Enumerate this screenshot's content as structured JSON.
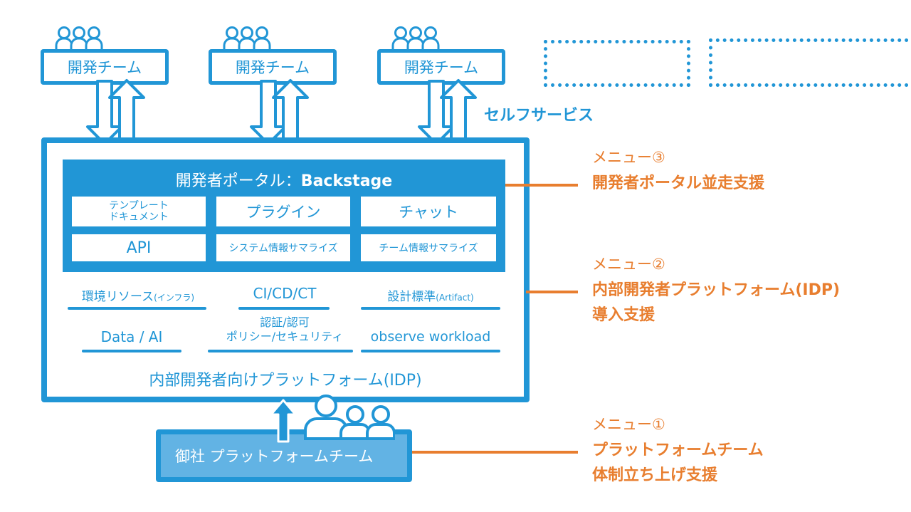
{
  "colors": {
    "primary_blue": "#2196d6",
    "light_blue": "#62b3e4",
    "accent_orange": "#e87e2f",
    "background": "#ffffff"
  },
  "dev_teams": [
    {
      "label": "開発チーム",
      "icon": "people-group-icon"
    },
    {
      "label": "開発チーム",
      "icon": "people-group-icon"
    },
    {
      "label": "開発チーム",
      "icon": "people-group-icon"
    }
  ],
  "placeholder_teams": 2,
  "self_service_label": "セルフサービス",
  "portal": {
    "title_prefix": "開発者ポータル：",
    "title_name": "Backstage",
    "cells": [
      {
        "line1": "テンプレート",
        "line2": "ドキュメント"
      },
      {
        "line1": "プラグイン"
      },
      {
        "line1": "チャット"
      },
      {
        "line1": "API"
      },
      {
        "line1": "システム情報サマライズ"
      },
      {
        "line1": "チーム情報サマライズ"
      }
    ]
  },
  "idp_features": [
    {
      "main": "環境リソース",
      "sub": "(インフラ)"
    },
    {
      "main": "CI/CD/CT"
    },
    {
      "main": "設計標準",
      "sub": "(Artifact)"
    },
    {
      "main": "Data / AI"
    },
    {
      "main": "認証/認可",
      "line2": "ポリシー/セキュリティ"
    },
    {
      "main": "observe workload"
    }
  ],
  "idp_label": "内部開発者向けプラットフォーム(IDP)",
  "platform_team": {
    "label": "御社 プラットフォームチーム",
    "icon": "people-group-icon"
  },
  "menus": [
    {
      "number": "メニュー③",
      "title_lines": [
        "開発者ポータル並走支援"
      ]
    },
    {
      "number": "メニュー②",
      "title_lines": [
        "内部開発者プラットフォーム(IDP)",
        "導入支援"
      ]
    },
    {
      "number": "メニュー①",
      "title_lines": [
        "プラットフォームチーム",
        "体制立ち上げ支援"
      ]
    }
  ]
}
